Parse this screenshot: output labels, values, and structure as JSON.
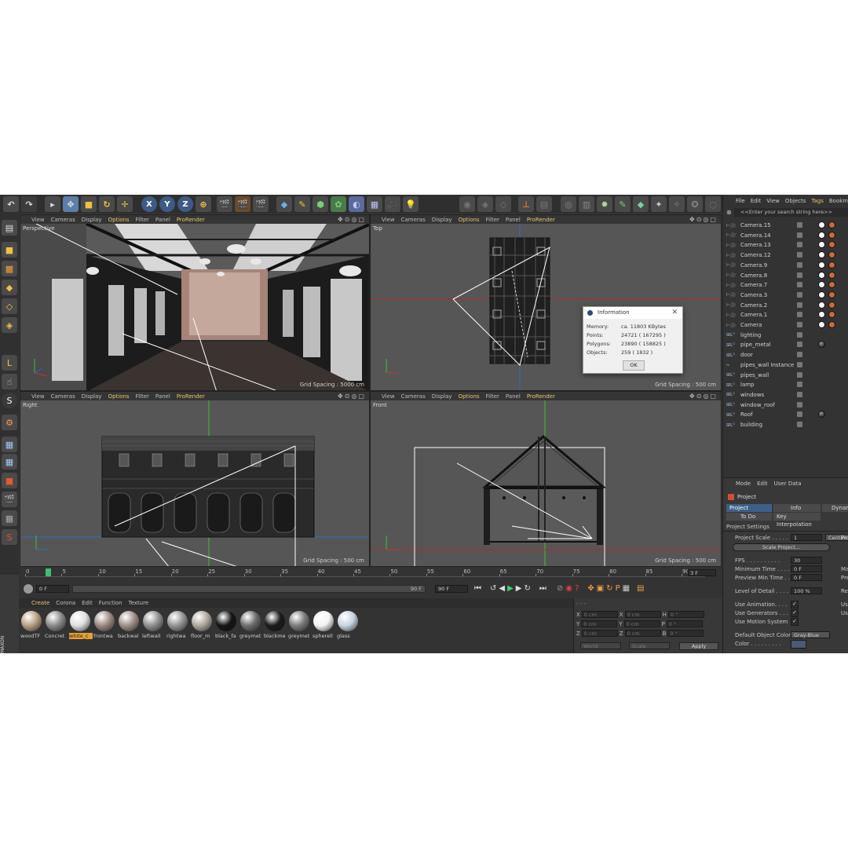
{
  "viewport_menu": [
    "View",
    "Cameras",
    "Display",
    "Options",
    "Filter",
    "Panel",
    "ProRender"
  ],
  "viewports": [
    {
      "label": "Perspective",
      "grid": "Grid Spacing : 5000 cm"
    },
    {
      "label": "Top",
      "grid": "Grid Spacing : 500 cm"
    },
    {
      "label": "Right",
      "grid": "Grid Spacing : 500 cm"
    },
    {
      "label": "Front",
      "grid": "Grid Spacing : 500 cm"
    }
  ],
  "toolbar": {
    "axis_x": "X",
    "axis_y": "Y",
    "axis_z": "Z"
  },
  "info_dialog": {
    "title": "Information",
    "rows": [
      {
        "label": "Memory:",
        "value": "ca. 11803 KBytes"
      },
      {
        "label": "Points:",
        "value": "24721 ( 167295 )"
      },
      {
        "label": "Polygons:",
        "value": "23890 ( 158825 )"
      },
      {
        "label": "Objects:",
        "value": "259 ( 1832 )"
      }
    ],
    "ok": "OK"
  },
  "timeline": {
    "ticks": [
      "0",
      "3",
      "5",
      "10",
      "15",
      "20",
      "25",
      "30",
      "35",
      "40",
      "45",
      "50",
      "55",
      "60",
      "65",
      "70",
      "75",
      "80",
      "85",
      "90"
    ],
    "current_frame": "3 F",
    "start_field": "0 F",
    "end_field": "90 F",
    "end_field2": "90 F"
  },
  "material_menu": [
    "Create",
    "Corona",
    "Edit",
    "Function",
    "Texture"
  ],
  "materials": [
    {
      "name": "woodTF",
      "color": "#b8a184"
    },
    {
      "name": "Concret",
      "color": "#8a8a8a"
    },
    {
      "name": "white_c",
      "color": "#e0e0e0"
    },
    {
      "name": "frontwa",
      "color": "#9c8a80"
    },
    {
      "name": "backwal",
      "color": "#a09088"
    },
    {
      "name": "leftwall",
      "color": "#8f8f8f"
    },
    {
      "name": "rightwa",
      "color": "#949494"
    },
    {
      "name": "floor_m",
      "color": "#b0a89e"
    },
    {
      "name": "black_fa",
      "color": "#151515"
    },
    {
      "name": "greymet",
      "color": "#6e6e6e"
    },
    {
      "name": "blackme",
      "color": "#1c1c1c"
    },
    {
      "name": "greymet",
      "color": "#7c7c7c"
    },
    {
      "name": "spherell",
      "color": "#f4f4f4"
    },
    {
      "name": "glass",
      "color": "#c8d4e0"
    }
  ],
  "coords": {
    "rows": [
      {
        "a": "X",
        "av": "0 cm",
        "b": "X",
        "bv": "0 cm",
        "c": "H",
        "cv": "0 °"
      },
      {
        "a": "Y",
        "av": "0 cm",
        "b": "Y",
        "bv": "0 cm",
        "c": "P",
        "cv": "0 °"
      },
      {
        "a": "Z",
        "av": "0 cm",
        "b": "Z",
        "bv": "0 cm",
        "c": "B",
        "cv": "0 °"
      }
    ],
    "world": "World",
    "scale": "Scale",
    "apply": "Apply"
  },
  "object_menu": [
    "File",
    "Edit",
    "View",
    "Objects",
    "Tags",
    "Bookm"
  ],
  "object_search": "<<Enter your search string here>>",
  "objects": [
    {
      "name": "Camera.15",
      "icon": "camera",
      "tags": true
    },
    {
      "name": "Camera.14",
      "icon": "camera",
      "tags": true
    },
    {
      "name": "Camera.13",
      "icon": "camera",
      "tags": true
    },
    {
      "name": "Camera.12",
      "icon": "camera",
      "tags": true
    },
    {
      "name": "Camera.9",
      "icon": "camera",
      "tags": true
    },
    {
      "name": "Camera.8",
      "icon": "camera",
      "tags": true
    },
    {
      "name": "Camera.7",
      "icon": "camera",
      "tags": true
    },
    {
      "name": "Camera.3",
      "icon": "camera",
      "tags": true
    },
    {
      "name": "Camera.2",
      "icon": "camera",
      "tags": true
    },
    {
      "name": "Camera.1",
      "icon": "camera",
      "tags": true
    },
    {
      "name": "Camera",
      "icon": "camera",
      "tags": true
    },
    {
      "name": "lighting",
      "icon": "null",
      "tags": false
    },
    {
      "name": "pipe_metal",
      "icon": "null",
      "tags": false,
      "material": true
    },
    {
      "name": "door",
      "icon": "null",
      "tags": false
    },
    {
      "name": "pipes_wall Instance",
      "icon": "instance",
      "tags": false
    },
    {
      "name": "pipes_wall",
      "icon": "null",
      "tags": false
    },
    {
      "name": "lamp",
      "icon": "null",
      "tags": false
    },
    {
      "name": "windows",
      "icon": "null",
      "tags": false
    },
    {
      "name": "window_roof",
      "icon": "null",
      "tags": false
    },
    {
      "name": "Roof",
      "icon": "null",
      "tags": false,
      "material": true
    },
    {
      "name": "building",
      "icon": "null",
      "tags": false
    }
  ],
  "attr_menu": [
    "Mode",
    "Edit",
    "User Data"
  ],
  "attr": {
    "header": "Project",
    "tabs": [
      "Project Settings",
      "Info",
      "Dynam"
    ],
    "subtabs": [
      "To Do",
      "Key Interpolation"
    ],
    "section": "Project Settings",
    "project_scale_label": "Project Scale . . . . .",
    "project_scale_value": "1",
    "project_scale_unit": "Centim",
    "scale_project_btn": "Scale Project...",
    "fps_label": "FPS . . . . . . . . . .",
    "fps_value": "30",
    "min_time_label": "Minimum Time . . . .",
    "min_time_value": "0 F",
    "prev_min_label": "Preview Min Time . .",
    "prev_min_value": "0 F",
    "lod_label": "Level of Detail . . . .",
    "lod_value": "100 %",
    "use_anim": "Use Animation. . . .",
    "use_gen": "Use Generators . . .",
    "use_motion": "Use Motion System",
    "default_color_label": "Default Object Color",
    "default_color_value": "Gray-Blue",
    "color_label": "Color . . . . . . . . .",
    "right_col": [
      "Pro",
      "Ma",
      "Pre",
      "Re",
      "Us",
      "Us"
    ]
  }
}
